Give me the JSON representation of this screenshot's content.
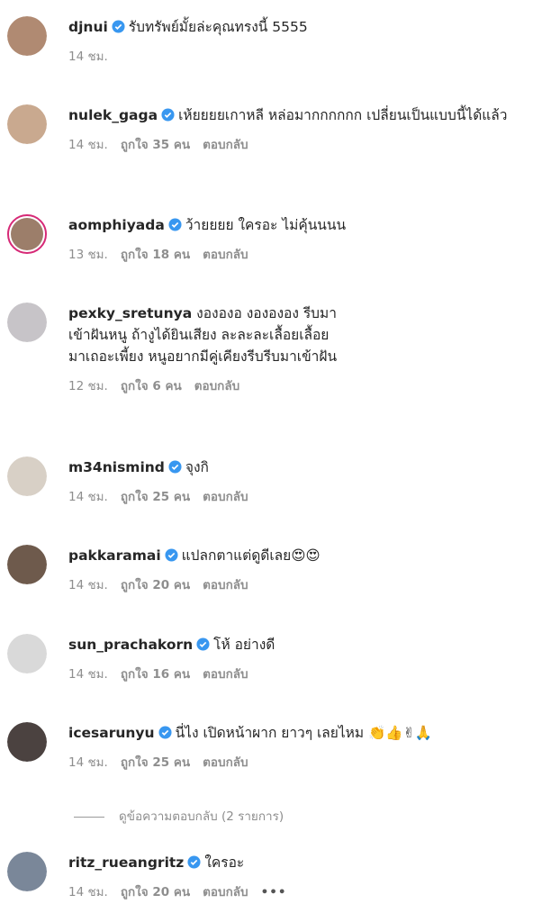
{
  "comments": [
    {
      "username": "djnui",
      "verified": true,
      "story": false,
      "text": "รับทรัพย์มั้ยล่ะคุณทรงนี้ 5555",
      "time": "14 ชม.",
      "likes": "",
      "reply": "",
      "avatar_color": "#b08a72"
    },
    {
      "username": "nulek_gaga",
      "verified": true,
      "story": false,
      "text": "เห้ยยยยเกาหลี หล่อมากกกกกก เปลี่ยนเป็นแบบนี้ได้แล้ว",
      "time": "14 ชม.",
      "likes": "ถูกใจ 35 คน",
      "reply": "ตอบกลับ",
      "avatar_color": "#c9a98f"
    },
    {
      "username": "aomphiyada",
      "verified": true,
      "story": true,
      "text": "ว้ายยยย ใครอะ ไม่คุ้นนนน",
      "time": "13 ชม.",
      "likes": "ถูกใจ 18 คน",
      "reply": "ตอบกลับ",
      "avatar_color": "#9c7e6a"
    },
    {
      "username": "pexky_sretunya",
      "verified": false,
      "story": false,
      "text": "งององอ งองององ รีบมาเข้าฝันหนู ถ้างูได้ยินเสียง ละละละเลื้อยเลื้อยมาเถอะเพี้ยง หนูอยากมีคู่เคียงรีบรีบมาเข้าฝัน",
      "time": "12 ชม.",
      "likes": "ถูกใจ 6 คน",
      "reply": "ตอบกลับ",
      "avatar_color": "#c7c4c8"
    },
    {
      "username": "m34nismind",
      "verified": true,
      "story": false,
      "text": "จุงกิ",
      "time": "14 ชม.",
      "likes": "ถูกใจ 25 คน",
      "reply": "ตอบกลับ",
      "avatar_color": "#d8d0c6"
    },
    {
      "username": "pakkaramai",
      "verified": true,
      "story": false,
      "text": "แปลกตาแต่ดูดีเลย😍😍",
      "time": "14 ชม.",
      "likes": "ถูกใจ 20 คน",
      "reply": "ตอบกลับ",
      "avatar_color": "#6e5a4c"
    },
    {
      "username": "sun_prachakorn",
      "verified": true,
      "story": false,
      "text": "โห้ อย่างดี",
      "time": "14 ชม.",
      "likes": "ถูกใจ 16 คน",
      "reply": "ตอบกลับ",
      "avatar_color": "#d9d9d9"
    },
    {
      "username": "icesarunyu",
      "verified": true,
      "story": false,
      "text": "นี่ไง เปิดหน้าผาก ยาวๆ เลยไหม 👏👍✌🙏",
      "time": "14 ชม.",
      "likes": "ถูกใจ 25 คน",
      "reply": "ตอบกลับ",
      "avatar_color": "#4b4240"
    },
    {
      "username": "ritz_rueangritz",
      "verified": true,
      "story": false,
      "text": "ใครอะ",
      "time": "14 ชม.",
      "likes": "ถูกใจ 20 คน",
      "reply": "ตอบกลับ",
      "more": "•••",
      "avatar_color": "#7a8799"
    }
  ],
  "view_replies": "ดูข้อความตอบกลับ (2 รายการ)",
  "colors": {
    "verified": "#3897f0",
    "story_ring": "#d62976",
    "muted": "#8e8e8e"
  }
}
